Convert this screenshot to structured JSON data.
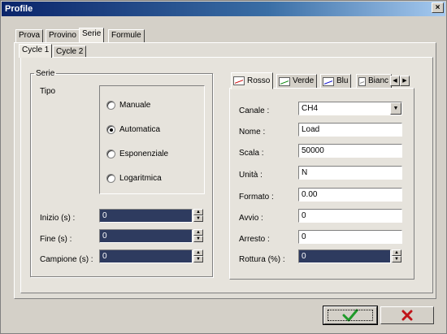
{
  "window": {
    "title": "Profile",
    "close_label": "×"
  },
  "tabs": [
    {
      "label": "Prova"
    },
    {
      "label": "Provino"
    },
    {
      "label": "Serie"
    },
    {
      "label": "Formule"
    }
  ],
  "subtabs": [
    {
      "label": "Cycle 1"
    },
    {
      "label": "Cycle 2"
    }
  ],
  "serie": {
    "group_label": "Serie",
    "tipo_label": "Tipo",
    "options": [
      {
        "label": "Manuale",
        "checked": false
      },
      {
        "label": "Automatica",
        "checked": true
      },
      {
        "label": "Esponenziale",
        "checked": false
      },
      {
        "label": "Logaritmica",
        "checked": false
      }
    ],
    "fields": [
      {
        "label": "Inizio (s) :",
        "value": "0"
      },
      {
        "label": "Fine (s) :",
        "value": "0"
      },
      {
        "label": "Campione (s) :",
        "value": "0"
      }
    ]
  },
  "channel_tabs": [
    {
      "label": "Rosso",
      "color": "#cc0000"
    },
    {
      "label": "Verde",
      "color": "#008000"
    },
    {
      "label": "Blu",
      "color": "#0000cc"
    },
    {
      "label": "Bianc",
      "color": "#808080"
    }
  ],
  "channel": {
    "canale": {
      "label": "Canale :",
      "value": "CH4"
    },
    "nome": {
      "label": "Nome :",
      "value": "Load"
    },
    "scala": {
      "label": "Scala :",
      "value": "50000"
    },
    "unita": {
      "label": "Unità :",
      "value": "N"
    },
    "formato": {
      "label": "Formato :",
      "value": "0.00"
    },
    "avvio": {
      "label": "Avvio :",
      "value": "0"
    },
    "arresto": {
      "label": "Arresto :",
      "value": "0"
    },
    "rottura": {
      "label": "Rottura (%) :",
      "value": "0"
    }
  },
  "colors": {
    "ok": "#1f9a2a",
    "cancel": "#c0141a",
    "field_dark": "#2e3b5f"
  }
}
